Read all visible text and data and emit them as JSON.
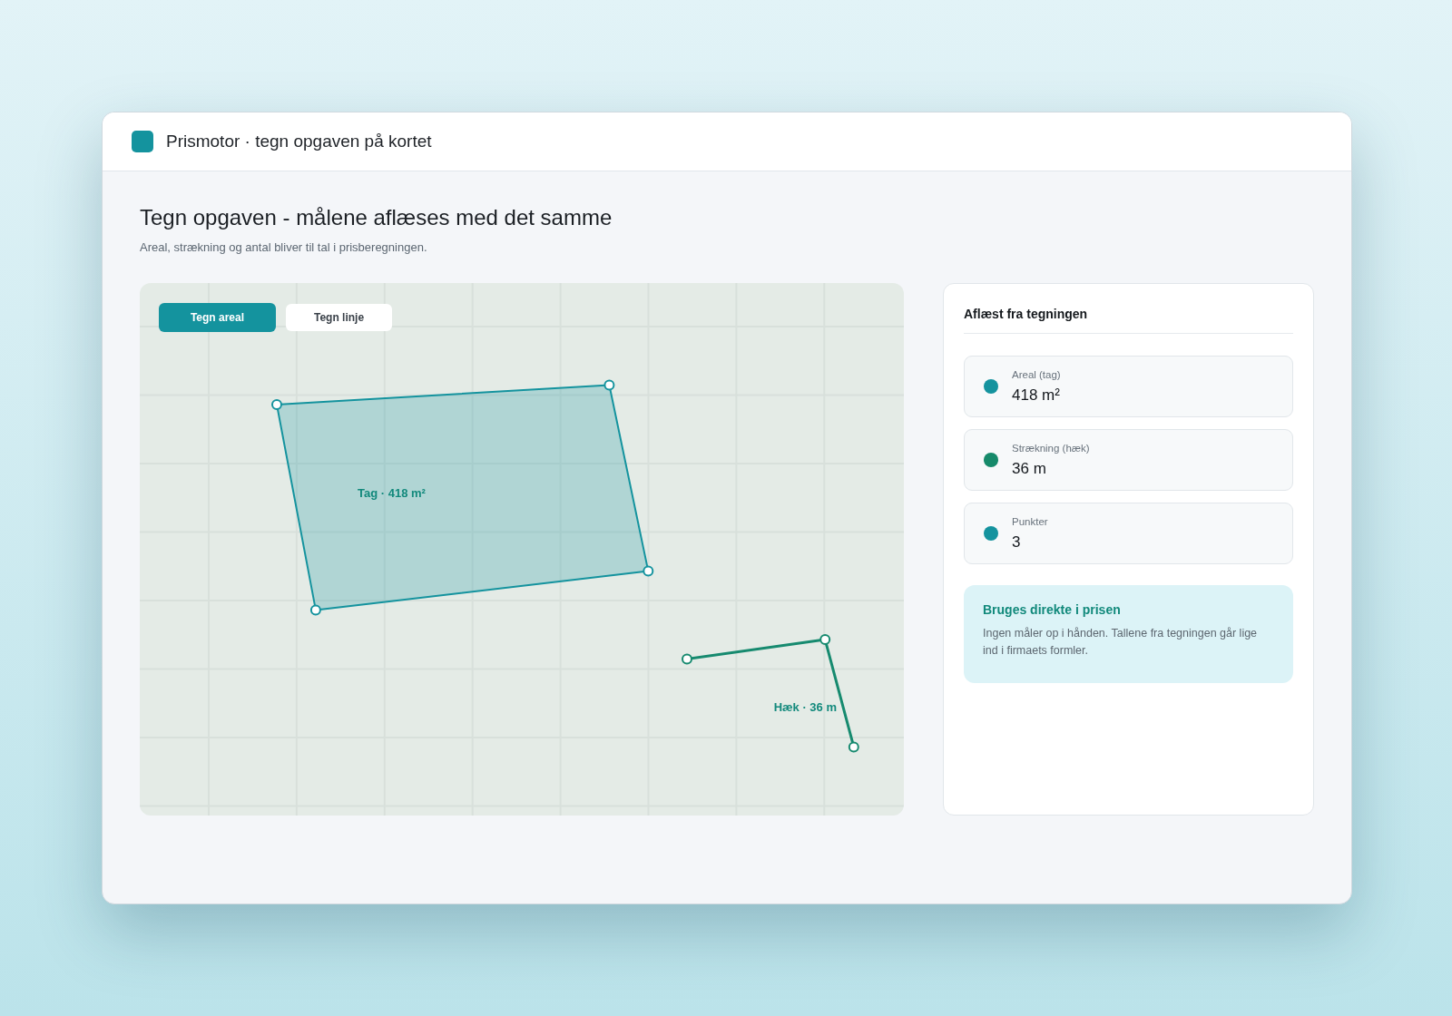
{
  "window": {
    "title": "Prismotor · tegn opgaven på kortet"
  },
  "page": {
    "heading": "Tegn opgaven - målene aflæses med det samme",
    "subtitle": "Areal, strækning og antal bliver til tal i prisberegningen."
  },
  "canvas": {
    "tools": [
      {
        "label": "Tegn areal",
        "selected": true
      },
      {
        "label": "Tegn linje",
        "selected": false
      }
    ],
    "shapes": [
      {
        "kind": "area",
        "label": "Tag · 418 m²",
        "color": "#14939e"
      },
      {
        "kind": "line",
        "label": "Hæk · 36 m",
        "color": "#168a6f"
      }
    ]
  },
  "readings": {
    "title": "Aflæst fra tegningen",
    "items": [
      {
        "label": "Areal (tag)",
        "value": "418 m²",
        "color": "#14939e"
      },
      {
        "label": "Strækning (hæk)",
        "value": "36 m",
        "color": "#168a6a"
      },
      {
        "label": "Punkter",
        "value": "3",
        "color": "#14939e"
      }
    ],
    "note": {
      "title": "Bruges direkte i prisen",
      "text": "Ingen måler op i hånden. Tallene fra tegningen går lige ind i firmaets formler."
    }
  }
}
